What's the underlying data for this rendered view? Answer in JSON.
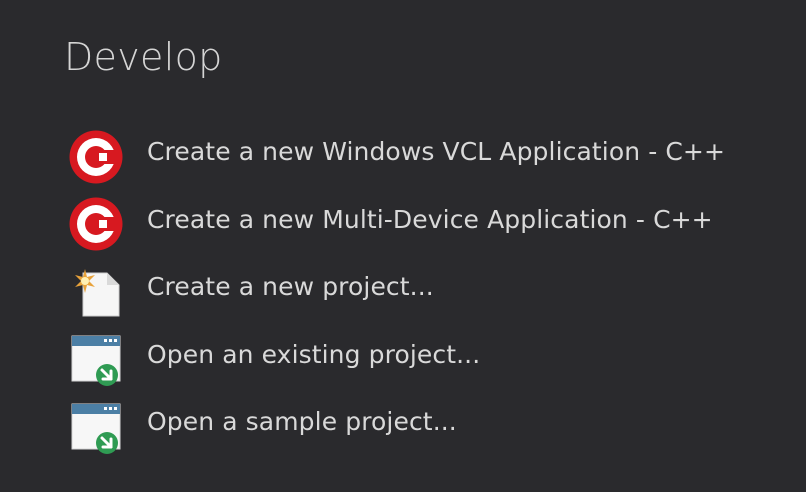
{
  "section": {
    "title": "Develop"
  },
  "actions": [
    {
      "label": "Create a new Windows VCL Application - C++",
      "icon": "cpp-icon"
    },
    {
      "label": "Create a new Multi-Device Application - C++",
      "icon": "cpp-icon"
    },
    {
      "label": "Create a new project...",
      "icon": "new-project-icon"
    },
    {
      "label": "Open an existing project...",
      "icon": "open-project-icon"
    },
    {
      "label": "Open a sample project...",
      "icon": "open-sample-icon"
    }
  ],
  "colors": {
    "background": "#2a2a2d",
    "text": "#d9d9d9",
    "cpp_red": "#d71920",
    "open_green": "#2f9b53"
  }
}
